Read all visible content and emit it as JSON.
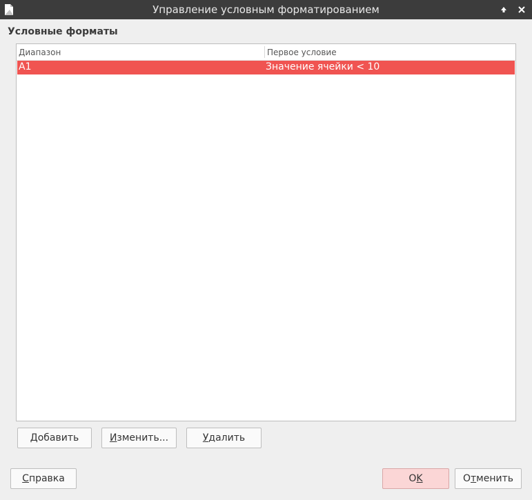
{
  "window": {
    "title": "Управление условным форматированием"
  },
  "section": {
    "title": "Условные форматы"
  },
  "list": {
    "columns": [
      "Диапазон",
      "Первое условие"
    ],
    "rows": [
      {
        "range": "A1",
        "condition": "Значение ячейки < 10",
        "selected": true
      }
    ]
  },
  "buttons": {
    "add": {
      "mnemonic": "Д",
      "rest": "обавить"
    },
    "edit": {
      "mnemonic": "И",
      "rest": "зменить..."
    },
    "delete": {
      "mnemonic": "У",
      "rest": "далить"
    },
    "help": {
      "mnemonic": "С",
      "rest": "правка"
    },
    "ok": {
      "pre": "O",
      "mnemonic": "K"
    },
    "cancel": {
      "pre": "О",
      "mnemonic": "т",
      "rest": "менить"
    }
  },
  "colors": {
    "selection": "#f05451",
    "titlebar": "#3c3c3c",
    "ok_default": "#fbd6d6"
  }
}
